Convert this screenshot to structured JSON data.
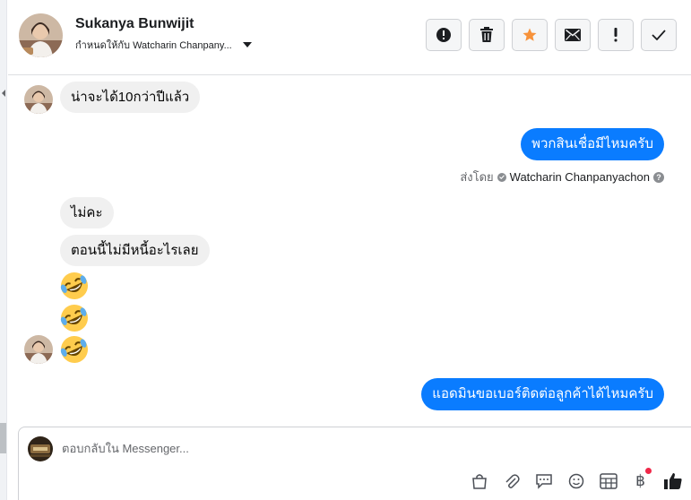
{
  "header": {
    "contact_name": "Sukanya Bunwijit",
    "assigned_label": "กำหนดให้กับ Watcharin Chanpany...",
    "actions": [
      "spam-report",
      "delete",
      "star",
      "mark-unread",
      "follow-up",
      "mark-done"
    ]
  },
  "conversation": {
    "messages": [
      {
        "from": "contact",
        "text": "น่าจะได้10กว่าปีแล้ว"
      },
      {
        "from": "page",
        "text": "พวกสินเชื่อมีไหมครับ"
      },
      {
        "from": "contact",
        "text": "ไม่คะ"
      },
      {
        "from": "contact",
        "text": "ตอนนี้ไม่มีหนี้อะไรเลย"
      },
      {
        "from": "contact",
        "emoji": "rolling-on-floor-laughing"
      },
      {
        "from": "contact",
        "emoji": "rolling-on-floor-laughing"
      },
      {
        "from": "contact",
        "emoji": "rolling-on-floor-laughing"
      },
      {
        "from": "page",
        "text": "แอดมินขอเบอร์ติดต่อลูกค้าได้ไหมครับ"
      }
    ],
    "sent_by_prefix": "ส่งโดย",
    "sent_by_name": "Watcharin Chanpanyachon"
  },
  "composer": {
    "placeholder": "ตอบกลับใน Messenger...",
    "value": "",
    "currency_symbol": "฿",
    "tools": [
      "shopping-bag-icon",
      "paperclip-icon",
      "saved-replies-icon",
      "emoji-icon",
      "appointment-icon",
      "payment-icon",
      "thumbs-up-icon"
    ]
  },
  "colors": {
    "outgoing_bubble": "#0a7cff",
    "incoming_bubble": "#f0f0f0",
    "star": "#f7923a",
    "notification_dot": "#f02849"
  }
}
